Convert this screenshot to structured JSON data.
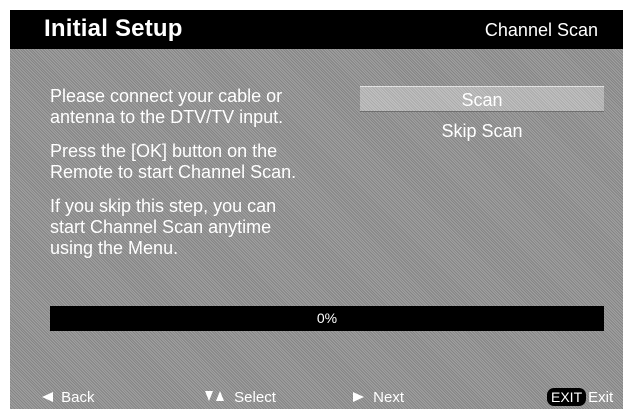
{
  "header": {
    "title": "Initial  Setup",
    "context": "Channel Scan"
  },
  "instructions": {
    "paragraphs": [
      "Please connect your cable or\nantenna to the DTV/TV input.",
      "Press the [OK] button on the\nRemote to start Channel Scan.",
      "If you skip this step, you can\nstart Channel Scan anytime\nusing the Menu."
    ]
  },
  "scan_menu": {
    "options": [
      {
        "label": "Scan",
        "selected": true
      },
      {
        "label": "Skip Scan",
        "selected": false
      }
    ]
  },
  "progress": {
    "value": 0,
    "label": "0%"
  },
  "footer": {
    "back_label": "Back",
    "select_label": "Select",
    "next_label": "Next",
    "exit_key": "EXIT",
    "exit_label": "Exit"
  },
  "icons": {
    "back": "left-arrow-icon",
    "select": "up-down-arrow-icon",
    "next": "right-arrow-icon"
  },
  "colors": {
    "background": "#8f8f8f",
    "header": "#000000",
    "text": "#ffffff",
    "progress_track": "#000000",
    "selected_option": "#b5b5b5"
  }
}
